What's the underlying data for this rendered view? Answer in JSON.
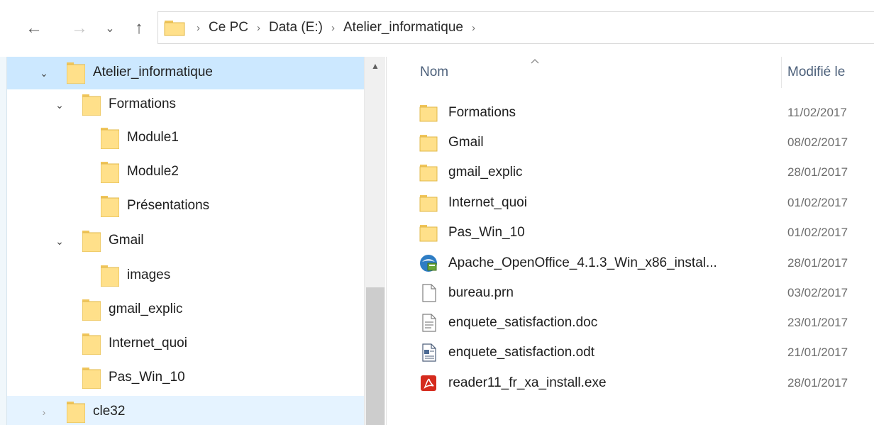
{
  "toolbar": {
    "back_glyph": "←",
    "forward_glyph": "→",
    "recent_glyph": "⌄",
    "up_glyph": "↑"
  },
  "address": {
    "crumbs": [
      "Ce PC",
      "Data (E:)",
      "Atelier_informatique"
    ],
    "separator": "›"
  },
  "navigation": {
    "expand_glyph": "⌄",
    "collapsed_glyph": "›",
    "scroll_up_glyph": "▲",
    "items": [
      {
        "label": "Atelier_informatique",
        "level": 0,
        "state": "expanded",
        "selected": true
      },
      {
        "label": "Formations",
        "level": 1,
        "state": "expanded"
      },
      {
        "label": "Module1",
        "level": 2,
        "state": "none"
      },
      {
        "label": "Module2",
        "level": 2,
        "state": "none"
      },
      {
        "label": "Présentations",
        "level": 2,
        "state": "none"
      },
      {
        "label": "Gmail",
        "level": 1,
        "state": "expanded"
      },
      {
        "label": "images",
        "level": 2,
        "state": "none"
      },
      {
        "label": "gmail_explic",
        "level": 1,
        "state": "none"
      },
      {
        "label": "Internet_quoi",
        "level": 1,
        "state": "none"
      },
      {
        "label": "Pas_Win_10",
        "level": 1,
        "state": "none"
      },
      {
        "label": "cle32",
        "level": 0,
        "state": "collapsed",
        "hovered": true
      }
    ]
  },
  "content": {
    "columns": {
      "name": "Nom",
      "modified": "Modifié le"
    },
    "files": [
      {
        "name": "Formations",
        "modified": "11/02/2017",
        "icon": "folder-icon"
      },
      {
        "name": "Gmail",
        "modified": "08/02/2017",
        "icon": "folder-icon"
      },
      {
        "name": "gmail_explic",
        "modified": "28/01/2017",
        "icon": "folder-icon"
      },
      {
        "name": "Internet_quoi",
        "modified": "01/02/2017",
        "icon": "folder-icon"
      },
      {
        "name": "Pas_Win_10",
        "modified": "01/02/2017",
        "icon": "folder-icon"
      },
      {
        "name": "Apache_OpenOffice_4.1.3_Win_x86_instal...",
        "modified": "28/01/2017",
        "icon": "installer-icon"
      },
      {
        "name": "bureau.prn",
        "modified": "03/02/2017",
        "icon": "blank-file-icon"
      },
      {
        "name": "enquete_satisfaction.doc",
        "modified": "23/01/2017",
        "icon": "document-icon"
      },
      {
        "name": "enquete_satisfaction.odt",
        "modified": "21/01/2017",
        "icon": "writer-document-icon"
      },
      {
        "name": "reader11_fr_xa_install.exe",
        "modified": "28/01/2017",
        "icon": "acrobat-installer-icon"
      }
    ]
  },
  "colors": {
    "folder_fill": "#FFE08A",
    "folder_back": "#F0C55A",
    "selected_row": "#CCE8FF",
    "hover_row": "#E5F3FF",
    "header_text": "#4C607A",
    "acrobat_red": "#D52B1E"
  }
}
